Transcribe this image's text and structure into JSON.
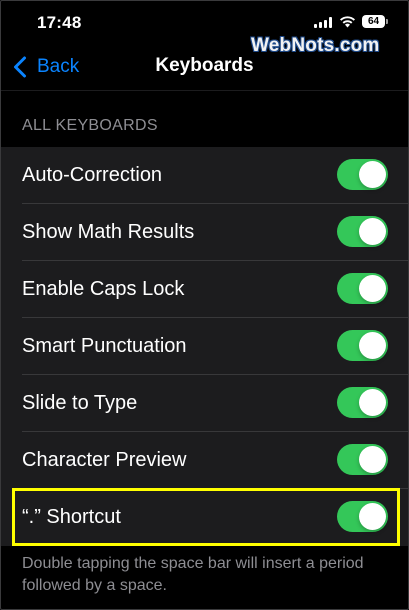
{
  "status_bar": {
    "time": "17:48",
    "battery_level": "64"
  },
  "nav": {
    "back_label": "Back",
    "title": "Keyboards"
  },
  "watermark": "WebNots.com",
  "section": {
    "header": "ALL KEYBOARDS"
  },
  "settings": [
    {
      "label": "Auto-Correction",
      "enabled": true
    },
    {
      "label": "Show Math Results",
      "enabled": true
    },
    {
      "label": "Enable Caps Lock",
      "enabled": true
    },
    {
      "label": "Smart Punctuation",
      "enabled": true
    },
    {
      "label": "Slide to Type",
      "enabled": true
    },
    {
      "label": "Character Preview",
      "enabled": true
    },
    {
      "label": "“.” Shortcut",
      "enabled": true
    }
  ],
  "footer_note": "Double tapping the space bar will insert a period followed by a space.",
  "colors": {
    "accent": "#0a84ff",
    "toggle_on": "#34c759",
    "highlight": "#ffff00",
    "background": "#000000",
    "cell": "#1c1c1e"
  }
}
